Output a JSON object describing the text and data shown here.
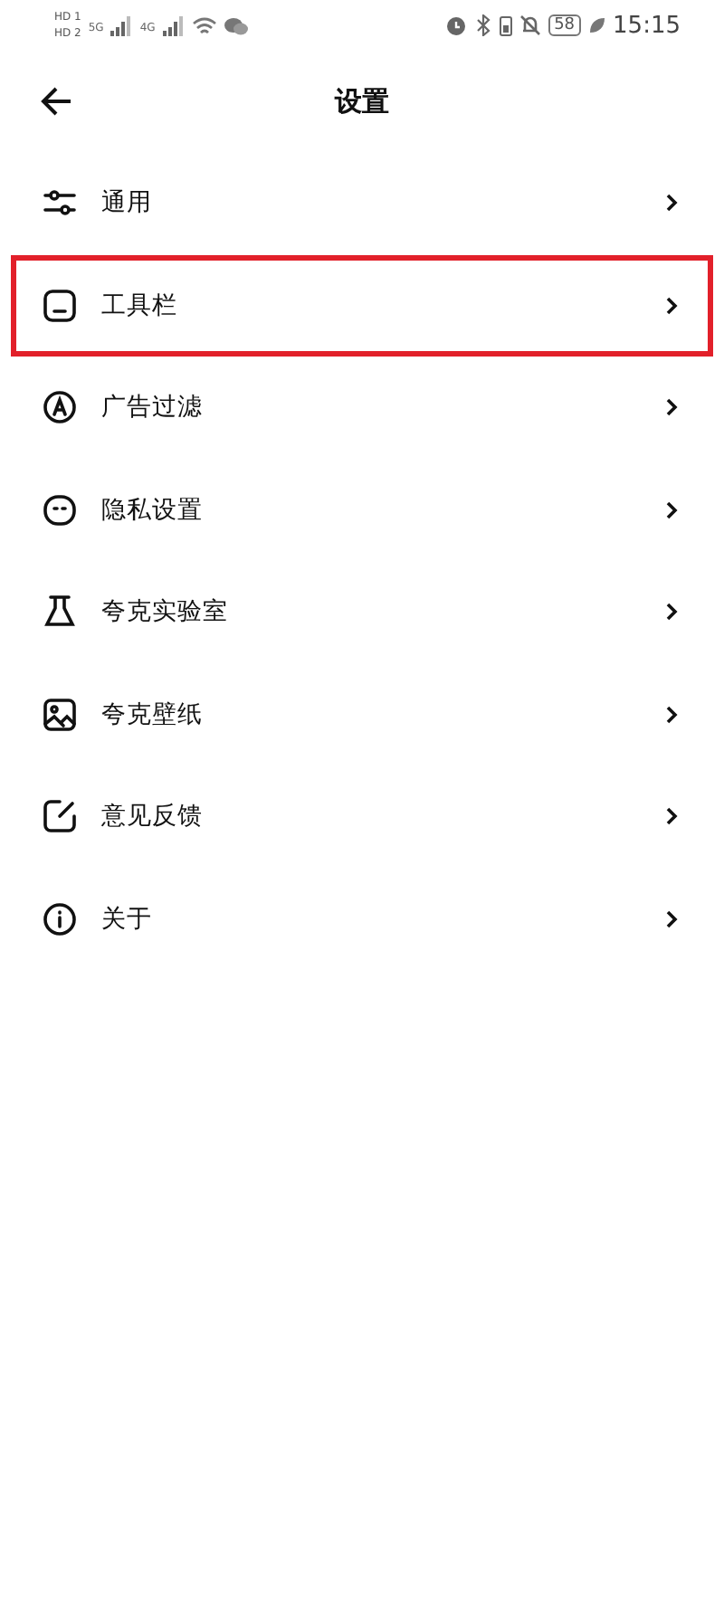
{
  "status_bar": {
    "sims": [
      {
        "badge": "HD",
        "slot": "1"
      },
      {
        "badge": "HD",
        "slot": "2"
      }
    ],
    "networks": [
      "5G",
      "4G"
    ],
    "battery": "58",
    "time": "15:15"
  },
  "header": {
    "title": "设置"
  },
  "items": [
    {
      "label": "通用",
      "kind": "sliders",
      "highlighted": false
    },
    {
      "label": "工具栏",
      "kind": "toolbar",
      "highlighted": true
    },
    {
      "label": "广告过滤",
      "kind": "adblock",
      "highlighted": false
    },
    {
      "label": "隐私设置",
      "kind": "privacy",
      "highlighted": false
    },
    {
      "label": "夸克实验室",
      "kind": "flask",
      "highlighted": false
    },
    {
      "label": "夸克壁纸",
      "kind": "image",
      "highlighted": false
    },
    {
      "label": "意见反馈",
      "kind": "edit",
      "highlighted": false
    },
    {
      "label": "关于",
      "kind": "info",
      "highlighted": false
    }
  ]
}
